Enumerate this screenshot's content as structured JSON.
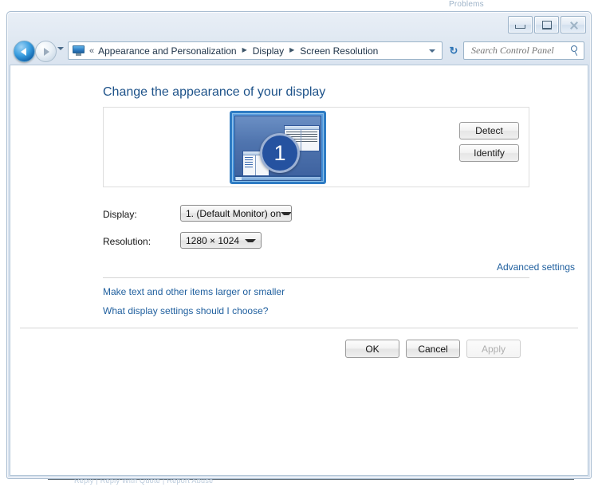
{
  "background": {
    "top_text": "Problems",
    "bottom_text": "Reply  |  Reply With Quote  |  Report Abuse"
  },
  "window": {
    "controls": {
      "minimize": "Minimize",
      "maximize": "Maximize",
      "close": "Close"
    }
  },
  "navbar": {
    "back": "Back",
    "forward": "Forward",
    "history_dropdown": "Recent pages",
    "breadcrumb_chevrons": "«",
    "breadcrumb": [
      {
        "label": "Appearance and Personalization"
      },
      {
        "label": "Display"
      },
      {
        "label": "Screen Resolution"
      }
    ],
    "breadcrumb_separator": "▶",
    "address_dropdown": "Previous locations",
    "refresh": "↻",
    "refresh_label": "Refresh",
    "search": {
      "placeholder": "Search Control Panel",
      "value": ""
    }
  },
  "main": {
    "page_title": "Change the appearance of your display",
    "preview": {
      "monitor_number": "1",
      "detect_label": "Detect",
      "identify_label": "Identify"
    },
    "fields": {
      "display_label": "Display:",
      "display_value": "1. (Default Monitor) on",
      "resolution_label": "Resolution:",
      "resolution_value": "1280 × 1024"
    },
    "links": {
      "advanced_settings": "Advanced settings",
      "make_text_larger": "Make text and other items larger or smaller",
      "what_display_settings": "What display settings should I choose?"
    },
    "buttons": {
      "ok": "OK",
      "cancel": "Cancel",
      "apply": "Apply"
    }
  },
  "colors": {
    "heading": "#1d5289",
    "link": "#1f5f9e",
    "accent": "#2552a0",
    "window_border": "#a8bcd0"
  }
}
